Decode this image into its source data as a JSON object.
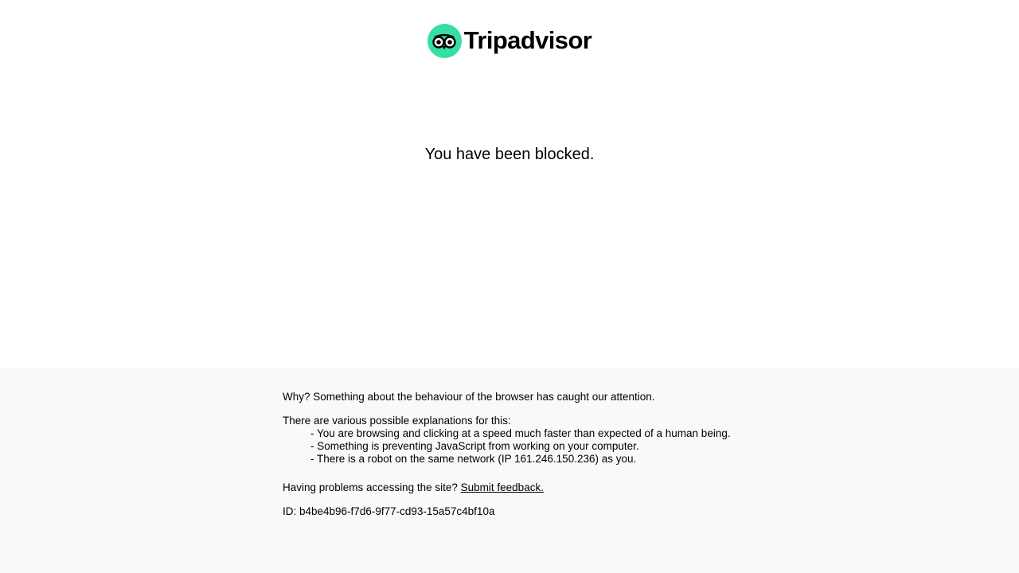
{
  "header": {
    "logo_text": "Tripadvisor",
    "logo_icon": "owl-eyes-icon",
    "logo_color": "#34e0a1"
  },
  "main": {
    "message": "You have been blocked."
  },
  "footer": {
    "why": "Why? Something about the behaviour of the browser has caught our attention.",
    "explanations_intro": "There are various possible explanations for this:",
    "explanations": [
      "- You are browsing and clicking at a speed much faster than expected of a human being.",
      "- Something is preventing JavaScript from working on your computer.",
      "- There is a robot on the same network (IP 161.246.150.236) as you."
    ],
    "problems_text": "Having problems accessing the site?",
    "feedback_link": "Submit feedback.",
    "id_text": "ID: b4be4b96-f7d6-9f77-cd93-15a57c4bf10a",
    "background": "#f9f9f9"
  }
}
